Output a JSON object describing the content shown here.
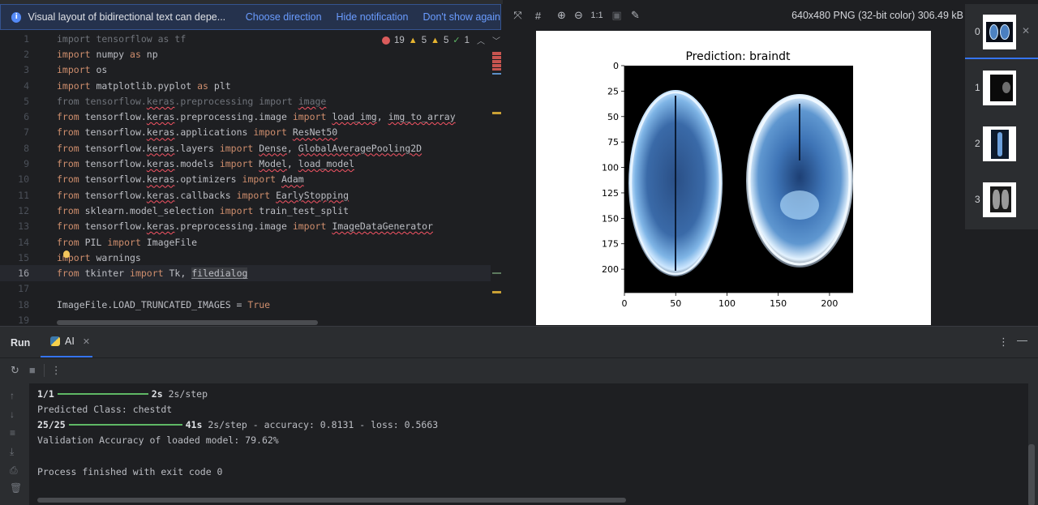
{
  "notification": {
    "message": "Visual layout of bidirectional text can depe...",
    "actions": [
      "Choose direction",
      "Hide notification",
      "Don't show again"
    ]
  },
  "inspections": {
    "errors": "19",
    "warnings1": "5",
    "warnings2": "5",
    "ok": "1"
  },
  "editor": {
    "current_line": 16,
    "lines": [
      {
        "n": "1",
        "tokens": [
          {
            "t": "import tensorflow as tf",
            "c": "dim"
          }
        ]
      },
      {
        "n": "2",
        "tokens": [
          {
            "t": "import",
            "c": "kw"
          },
          {
            "t": " numpy "
          },
          {
            "t": "as",
            "c": "kw"
          },
          {
            "t": " np"
          }
        ]
      },
      {
        "n": "3",
        "tokens": [
          {
            "t": "import",
            "c": "kw"
          },
          {
            "t": " os"
          }
        ]
      },
      {
        "n": "4",
        "tokens": [
          {
            "t": "import",
            "c": "kw"
          },
          {
            "t": " matplotlib.pyplot "
          },
          {
            "t": "as",
            "c": "kw"
          },
          {
            "t": " plt"
          }
        ]
      },
      {
        "n": "5",
        "tokens": [
          {
            "t": "from tensorflow.",
            "c": "dim"
          },
          {
            "t": "keras",
            "c": "dim sq"
          },
          {
            "t": ".preprocessing import ",
            "c": "dim"
          },
          {
            "t": "image",
            "c": "dim sq"
          }
        ]
      },
      {
        "n": "6",
        "tokens": [
          {
            "t": "from",
            "c": "kw"
          },
          {
            "t": " tensorflow."
          },
          {
            "t": "keras",
            "c": "sq"
          },
          {
            "t": ".preprocessing.image "
          },
          {
            "t": "import",
            "c": "kw"
          },
          {
            "t": " "
          },
          {
            "t": "load_img",
            "c": "sq"
          },
          {
            "t": ", "
          },
          {
            "t": "img_to_array",
            "c": "sq"
          }
        ]
      },
      {
        "n": "7",
        "tokens": [
          {
            "t": "from",
            "c": "kw"
          },
          {
            "t": " tensorflow."
          },
          {
            "t": "keras",
            "c": "sq"
          },
          {
            "t": ".applications "
          },
          {
            "t": "import",
            "c": "kw"
          },
          {
            "t": " "
          },
          {
            "t": "ResNet50",
            "c": "sq"
          }
        ]
      },
      {
        "n": "8",
        "tokens": [
          {
            "t": "from",
            "c": "kw"
          },
          {
            "t": " tensorflow."
          },
          {
            "t": "keras",
            "c": "sq"
          },
          {
            "t": ".layers "
          },
          {
            "t": "import",
            "c": "kw"
          },
          {
            "t": " "
          },
          {
            "t": "Dense",
            "c": "sq"
          },
          {
            "t": ", "
          },
          {
            "t": "GlobalAveragePooling2D",
            "c": "sq"
          }
        ]
      },
      {
        "n": "9",
        "tokens": [
          {
            "t": "from",
            "c": "kw"
          },
          {
            "t": " tensorflow."
          },
          {
            "t": "keras",
            "c": "sq"
          },
          {
            "t": ".models "
          },
          {
            "t": "import",
            "c": "kw"
          },
          {
            "t": " "
          },
          {
            "t": "Model",
            "c": "sq"
          },
          {
            "t": ", "
          },
          {
            "t": "load_model",
            "c": "sq"
          }
        ]
      },
      {
        "n": "10",
        "tokens": [
          {
            "t": "from",
            "c": "kw"
          },
          {
            "t": " tensorflow."
          },
          {
            "t": "keras",
            "c": "sq"
          },
          {
            "t": ".optimizers "
          },
          {
            "t": "import",
            "c": "kw"
          },
          {
            "t": " "
          },
          {
            "t": "Adam",
            "c": "sq"
          }
        ]
      },
      {
        "n": "11",
        "tokens": [
          {
            "t": "from",
            "c": "kw"
          },
          {
            "t": " tensorflow."
          },
          {
            "t": "keras",
            "c": "sq"
          },
          {
            "t": ".callbacks "
          },
          {
            "t": "import",
            "c": "kw"
          },
          {
            "t": " "
          },
          {
            "t": "EarlyStopping",
            "c": "sq"
          }
        ]
      },
      {
        "n": "12",
        "tokens": [
          {
            "t": "from",
            "c": "kw"
          },
          {
            "t": " sklearn.model_selection "
          },
          {
            "t": "import",
            "c": "kw"
          },
          {
            "t": " train_test_split"
          }
        ]
      },
      {
        "n": "13",
        "tokens": [
          {
            "t": "from",
            "c": "kw"
          },
          {
            "t": " tensorflow."
          },
          {
            "t": "keras",
            "c": "sq"
          },
          {
            "t": ".preprocessing.image "
          },
          {
            "t": "import",
            "c": "kw"
          },
          {
            "t": " "
          },
          {
            "t": "ImageDataGenerator",
            "c": "sq"
          }
        ]
      },
      {
        "n": "14",
        "tokens": [
          {
            "t": "from",
            "c": "kw"
          },
          {
            "t": " PIL "
          },
          {
            "t": "import",
            "c": "kw"
          },
          {
            "t": " ImageFile"
          }
        ]
      },
      {
        "n": "15",
        "tokens": [
          {
            "t": "import",
            "c": "kw"
          },
          {
            "t": " warnings"
          }
        ]
      },
      {
        "n": "16",
        "tokens": [
          {
            "t": "from",
            "c": "kw"
          },
          {
            "t": " tkinter "
          },
          {
            "t": "import",
            "c": "kw"
          },
          {
            "t": " Tk, "
          },
          {
            "t": "filedialog",
            "c": "hl sqd"
          }
        ]
      },
      {
        "n": "17",
        "tokens": []
      },
      {
        "n": "18",
        "tokens": [
          {
            "t": "ImageFile.LOAD_TRUNCATED_IMAGES = "
          },
          {
            "t": "True",
            "c": "kw"
          }
        ]
      },
      {
        "n": "19",
        "tokens": []
      }
    ]
  },
  "viewer": {
    "info": "640x480 PNG (32-bit color) 306.49 kB",
    "zoom_label": "1:1"
  },
  "figure": {
    "title": "Prediction: braindt",
    "x_ticks": [
      "0",
      "50",
      "100",
      "150",
      "200"
    ],
    "y_ticks": [
      "0",
      "25",
      "50",
      "75",
      "100",
      "125",
      "150",
      "175",
      "200"
    ]
  },
  "thumbnails": [
    {
      "index": "0",
      "selected": true
    },
    {
      "index": "1",
      "selected": false
    },
    {
      "index": "2",
      "selected": false
    },
    {
      "index": "3",
      "selected": false
    }
  ],
  "run": {
    "title": "Run",
    "tab_label": "AI",
    "console": {
      "l1_step": "1/1",
      "l1_time": "2s",
      "l1_rest": " 2s/step",
      "l2": "Predicted Class: chestdt",
      "l3_step": "25/25",
      "l3_time": "41s",
      "l3_rest": " 2s/step - accuracy: 0.8131 - loss: 0.5663",
      "l4": "Validation Accuracy of loaded model: 79.62%",
      "l5": "Process finished with exit code 0"
    }
  },
  "colors": {
    "accent": "#3574f0",
    "keyword": "#cf8e6d",
    "link": "#6a9cff",
    "progress": "#5fb865",
    "error": "#db5c5c",
    "warning": "#e6b430"
  }
}
